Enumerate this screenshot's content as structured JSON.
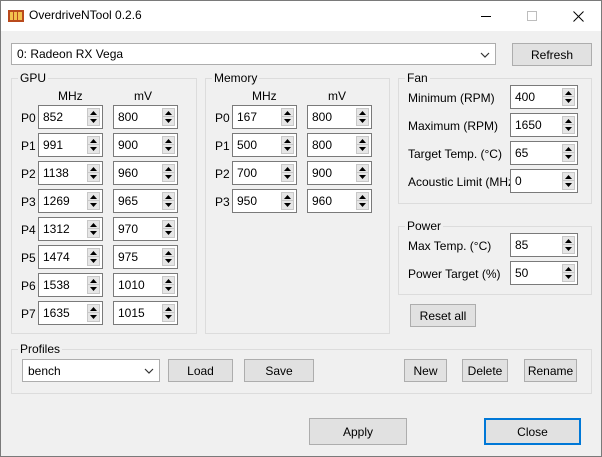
{
  "window": {
    "title": "OverdriveNTool 0.2.6",
    "icons": [
      "app-icon",
      "minimize-icon",
      "maximize-icon",
      "close-icon"
    ]
  },
  "device": {
    "selected": "0: Radeon RX Vega",
    "refresh_label": "Refresh"
  },
  "gpu": {
    "label": "GPU",
    "col_mhz": "MHz",
    "col_mv": "mV",
    "rows": [
      {
        "p": "P0",
        "mhz": "852",
        "mv": "800"
      },
      {
        "p": "P1",
        "mhz": "991",
        "mv": "900"
      },
      {
        "p": "P2",
        "mhz": "1138",
        "mv": "960"
      },
      {
        "p": "P3",
        "mhz": "1269",
        "mv": "965"
      },
      {
        "p": "P4",
        "mhz": "1312",
        "mv": "970"
      },
      {
        "p": "P5",
        "mhz": "1474",
        "mv": "975"
      },
      {
        "p": "P6",
        "mhz": "1538",
        "mv": "1010"
      },
      {
        "p": "P7",
        "mhz": "1635",
        "mv": "1015"
      }
    ]
  },
  "memory": {
    "label": "Memory",
    "col_mhz": "MHz",
    "col_mv": "mV",
    "rows": [
      {
        "p": "P0",
        "mhz": "167",
        "mv": "800"
      },
      {
        "p": "P1",
        "mhz": "500",
        "mv": "800"
      },
      {
        "p": "P2",
        "mhz": "700",
        "mv": "900"
      },
      {
        "p": "P3",
        "mhz": "950",
        "mv": "960"
      }
    ]
  },
  "fan": {
    "label": "Fan",
    "fields": [
      {
        "label": "Minimum (RPM)",
        "value": "400"
      },
      {
        "label": "Maximum (RPM)",
        "value": "1650"
      },
      {
        "label": "Target Temp. (°C)",
        "value": "65"
      },
      {
        "label": "Acoustic Limit (MHz)",
        "value": "0"
      }
    ]
  },
  "power": {
    "label": "Power",
    "fields": [
      {
        "label": "Max Temp. (°C)",
        "value": "85"
      },
      {
        "label": "Power Target (%)",
        "value": "50"
      }
    ]
  },
  "reset_all_label": "Reset all",
  "profiles": {
    "label": "Profiles",
    "selected": "bench",
    "load_label": "Load",
    "save_label": "Save",
    "new_label": "New",
    "delete_label": "Delete",
    "rename_label": "Rename"
  },
  "footer": {
    "apply_label": "Apply",
    "close_label": "Close"
  },
  "colors": {
    "accent": "#0078d7",
    "background": "#f0f0f0",
    "button": "#e1e1e1"
  }
}
